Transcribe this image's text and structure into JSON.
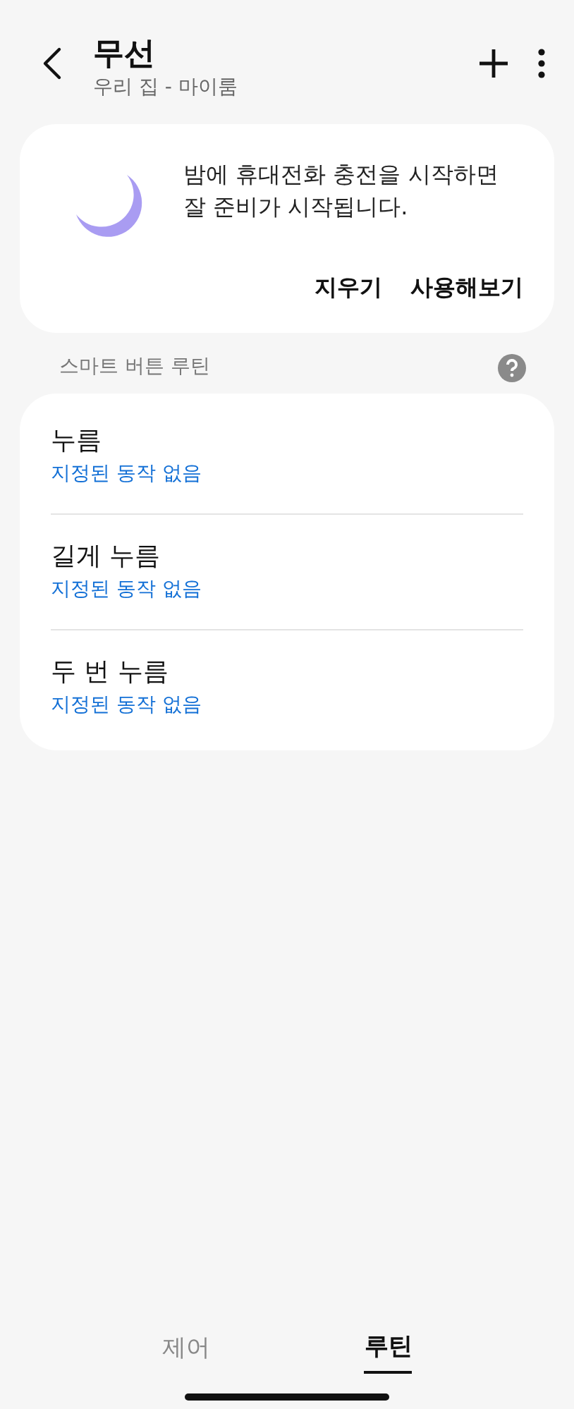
{
  "header": {
    "title": "무선",
    "subtitle": "우리 집 - 마이룸"
  },
  "suggestion": {
    "message": "밤에 휴대전화 충전을 시작하면\n잘 준비가 시작됩니다.",
    "actions": [
      "지우기",
      "사용해보기"
    ]
  },
  "section": {
    "title": "스마트 버튼 루틴"
  },
  "routines": [
    {
      "title": "누름",
      "status": "지정된 동작 없음"
    },
    {
      "title": "길게 누름",
      "status": "지정된 동작 없음"
    },
    {
      "title": "두 번 누름",
      "status": "지정된 동작 없음"
    }
  ],
  "tabs": [
    {
      "label": "제어",
      "selected": false
    },
    {
      "label": "루틴",
      "selected": true
    }
  ]
}
